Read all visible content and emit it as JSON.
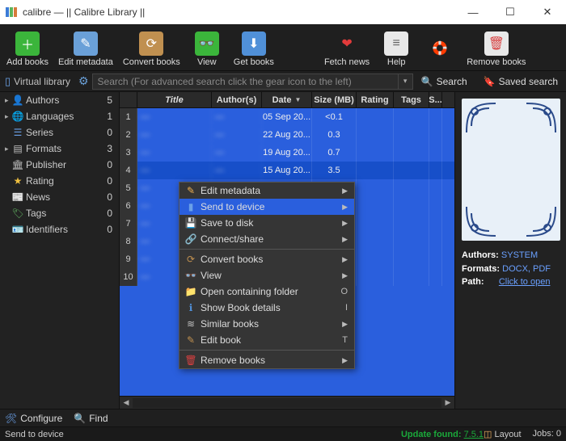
{
  "window": {
    "title": "calibre — || Calibre Library ||"
  },
  "toolbar": [
    {
      "id": "add-books",
      "label": "Add books",
      "bg": "#3bb53b",
      "glyph": "＋"
    },
    {
      "id": "edit-metadata",
      "label": "Edit metadata",
      "bg": "#6aa0d8",
      "glyph": "✎"
    },
    {
      "id": "convert-books",
      "label": "Convert books",
      "bg": "#c09050",
      "glyph": "⟳"
    },
    {
      "id": "view",
      "label": "View",
      "bg": "#3bb53b",
      "glyph": "👓"
    },
    {
      "id": "get-books",
      "label": "Get books",
      "bg": "#5090d8",
      "glyph": "⬇"
    },
    {
      "id": "fetch-news",
      "label": "Fetch news",
      "bg": "transparent",
      "glyph": "❤",
      "fg": "#e23b3b"
    },
    {
      "id": "help",
      "label": "Help",
      "bg": "#e8e8e8",
      "glyph": "≡",
      "fg": "#666"
    },
    {
      "id": "donate",
      "label": "",
      "bg": "transparent",
      "glyph": "🛟",
      "fg": "#fff"
    },
    {
      "id": "remove-books",
      "label": "Remove books",
      "bg": "#e8e8e8",
      "glyph": "🗑",
      "fg": "#d84040"
    }
  ],
  "searchbar": {
    "vlib": "Virtual library",
    "placeholder": "Search (For advanced search click the gear icon to the left)",
    "search_label": "Search",
    "saved_label": "Saved search"
  },
  "sidebar": [
    {
      "exp": "▸",
      "icon": "👤",
      "color": "#6aa0e8",
      "label": "Authors",
      "count": 5
    },
    {
      "exp": "▸",
      "icon": "🌐",
      "color": "#6aa0e8",
      "label": "Languages",
      "count": 1
    },
    {
      "exp": "",
      "icon": "☰",
      "color": "#6aa0e8",
      "label": "Series",
      "count": 0
    },
    {
      "exp": "▸",
      "icon": "▤",
      "color": "#c0c0c0",
      "label": "Formats",
      "count": 3
    },
    {
      "exp": "",
      "icon": "🏛",
      "color": "#c0c0c0",
      "label": "Publisher",
      "count": 0
    },
    {
      "exp": "",
      "icon": "★",
      "color": "#f0c040",
      "label": "Rating",
      "count": 0
    },
    {
      "exp": "",
      "icon": "📰",
      "color": "#c0c0c0",
      "label": "News",
      "count": 0
    },
    {
      "exp": "",
      "icon": "🏷",
      "color": "#60b060",
      "label": "Tags",
      "count": 0
    },
    {
      "exp": "",
      "icon": "🪪",
      "color": "#c0c0c0",
      "label": "Identifiers",
      "count": 0
    }
  ],
  "table": {
    "headers": {
      "num": "",
      "title": "Title",
      "authors": "Author(s)",
      "date": "Date",
      "size": "Size (MB)",
      "rating": "Rating",
      "tags": "Tags",
      "series": "S..."
    },
    "rows": [
      {
        "n": 1,
        "title": "—",
        "authors": "—",
        "date": "05 Sep 20...",
        "size": "<0.1"
      },
      {
        "n": 2,
        "title": "—",
        "authors": "—",
        "date": "22 Aug 20...",
        "size": "0.3"
      },
      {
        "n": 3,
        "title": "—",
        "authors": "—",
        "date": "19 Aug 20...",
        "size": "0.7"
      },
      {
        "n": 4,
        "title": "—",
        "authors": "—",
        "date": "15 Aug 20...",
        "size": "3.5",
        "selected": true
      },
      {
        "n": 5,
        "title": "—",
        "authors": "—",
        "date": "",
        "size": ""
      },
      {
        "n": 6,
        "title": "—",
        "authors": "—",
        "date": "",
        "size": ""
      },
      {
        "n": 7,
        "title": "—",
        "authors": "—",
        "date": "",
        "size": ""
      },
      {
        "n": 8,
        "title": "—",
        "authors": "—",
        "date": "",
        "size": ""
      },
      {
        "n": 9,
        "title": "—",
        "authors": "—",
        "date": "",
        "size": ""
      },
      {
        "n": 10,
        "title": "—",
        "authors": "—",
        "date": "",
        "size": ""
      }
    ]
  },
  "rightpane": {
    "authors_k": "Authors:",
    "authors_v": "SYSTEM",
    "formats_k": "Formats:",
    "formats_v": "DOCX, PDF",
    "path_k": "Path:",
    "path_v": "Click to open"
  },
  "context_menu": [
    {
      "icon": "✎",
      "color": "#f0b050",
      "label": "Edit metadata",
      "sub": true
    },
    {
      "icon": "▮",
      "color": "#6aa0e8",
      "label": "Send to device",
      "sub": true,
      "hov": true
    },
    {
      "icon": "💾",
      "color": "#c0c0c0",
      "label": "Save to disk",
      "sub": true
    },
    {
      "icon": "🔗",
      "color": "#c0c0c0",
      "label": "Connect/share",
      "sub": true
    },
    {
      "sep": true
    },
    {
      "icon": "⟳",
      "color": "#c09050",
      "label": "Convert books",
      "sub": true
    },
    {
      "icon": "👓",
      "color": "#c0c0c0",
      "label": "View",
      "sub": true
    },
    {
      "icon": "📁",
      "color": "#6aa0e8",
      "label": "Open containing folder",
      "sc": "O"
    },
    {
      "icon": "ℹ",
      "color": "#5090d8",
      "label": "Show Book details",
      "sc": "I"
    },
    {
      "icon": "≋",
      "color": "#c0c0c0",
      "label": "Similar books",
      "sub": true
    },
    {
      "icon": "✎",
      "color": "#c09050",
      "label": "Edit book",
      "sc": "T"
    },
    {
      "sep": true
    },
    {
      "icon": "🗑",
      "color": "#d84040",
      "label": "Remove books",
      "sub": true
    }
  ],
  "bottombar": {
    "configure": "Configure",
    "find": "Find"
  },
  "status": {
    "left": "Send to device",
    "update_label": "Update found:",
    "version": "7.5.1",
    "layout": "Layout",
    "jobs": "Jobs: 0"
  }
}
